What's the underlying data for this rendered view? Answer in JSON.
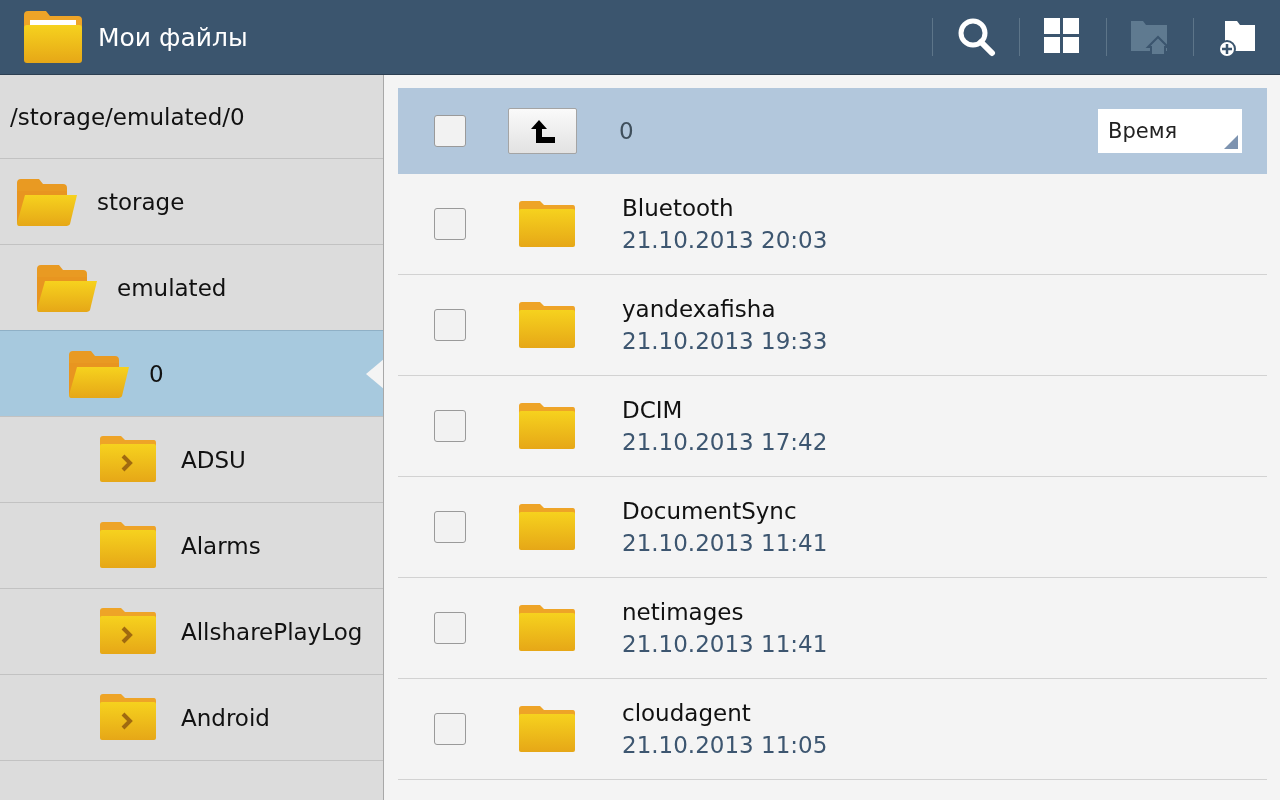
{
  "app_bar": {
    "title": "Мои файлы",
    "actions": [
      {
        "kind": "search",
        "disabled": false
      },
      {
        "kind": "grid",
        "disabled": false
      },
      {
        "kind": "home",
        "disabled": true
      },
      {
        "kind": "new-folder",
        "disabled": false
      }
    ]
  },
  "sidebar": {
    "path": "/storage/emulated/0",
    "tree": [
      {
        "name": "storage",
        "kind": "open",
        "selected": false,
        "children": [
          {
            "name": "emulated",
            "kind": "open",
            "selected": false,
            "children": [
              {
                "name": "0",
                "kind": "open",
                "selected": true,
                "children": [
                  {
                    "name": "ADSU",
                    "kind": "chevron",
                    "selected": false
                  },
                  {
                    "name": "Alarms",
                    "kind": "plain",
                    "selected": false
                  },
                  {
                    "name": "AllsharePlayLog",
                    "kind": "chevron",
                    "selected": false
                  },
                  {
                    "name": "Android",
                    "kind": "chevron",
                    "selected": false
                  }
                ]
              }
            ]
          }
        ]
      }
    ]
  },
  "list_header": {
    "checked": false,
    "folder": "0",
    "sort": "Время"
  },
  "files": [
    {
      "name": "Bluetooth",
      "date": "21.10.2013 20:03",
      "checked": false
    },
    {
      "name": "yandexafisha",
      "date": "21.10.2013 19:33",
      "checked": false
    },
    {
      "name": "DCIM",
      "date": "21.10.2013 17:42",
      "checked": false
    },
    {
      "name": "DocumentSync",
      "date": "21.10.2013 11:41",
      "checked": false
    },
    {
      "name": "netimages",
      "date": "21.10.2013 11:41",
      "checked": false
    },
    {
      "name": "cloudagent",
      "date": "21.10.2013 11:05",
      "checked": false
    }
  ]
}
